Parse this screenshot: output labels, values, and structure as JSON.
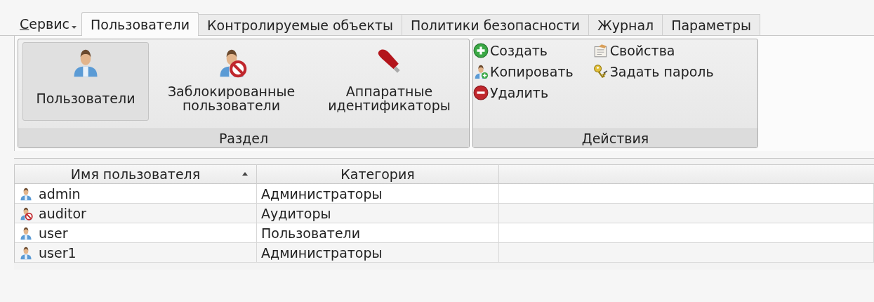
{
  "menu": {
    "label": "Сервис"
  },
  "tabs": [
    {
      "label": "Пользователи",
      "selected": true
    },
    {
      "label": "Контролируемые объекты",
      "selected": false
    },
    {
      "label": "Политики безопасности",
      "selected": false
    },
    {
      "label": "Журнал",
      "selected": false
    },
    {
      "label": "Параметры",
      "selected": false
    }
  ],
  "ribbon": {
    "groups": [
      {
        "kind": "large",
        "title": "Раздел",
        "items": [
          {
            "label": "Пользователи",
            "selected": true
          },
          {
            "label": "Заблокированные пользователи",
            "selected": false
          },
          {
            "label": "Аппаратные идентификаторы",
            "selected": false
          }
        ]
      },
      {
        "kind": "small",
        "title": "Действия",
        "items": [
          {
            "label": "Создать"
          },
          {
            "label": "Копировать"
          },
          {
            "label": "Удалить"
          },
          {
            "label": "Свойства"
          },
          {
            "label": "Задать пароль"
          }
        ]
      }
    ]
  },
  "table": {
    "columns": [
      {
        "label": "Имя пользователя",
        "sorted": true
      },
      {
        "label": "Категория",
        "sorted": false
      }
    ],
    "rows": [
      {
        "name": "admin",
        "kind": "user",
        "category": "Администраторы"
      },
      {
        "name": "auditor",
        "kind": "blocked",
        "category": "Аудиторы"
      },
      {
        "name": "user",
        "kind": "user",
        "category": "Пользователи"
      },
      {
        "name": "user1",
        "kind": "user",
        "category": "Администраторы"
      }
    ]
  }
}
